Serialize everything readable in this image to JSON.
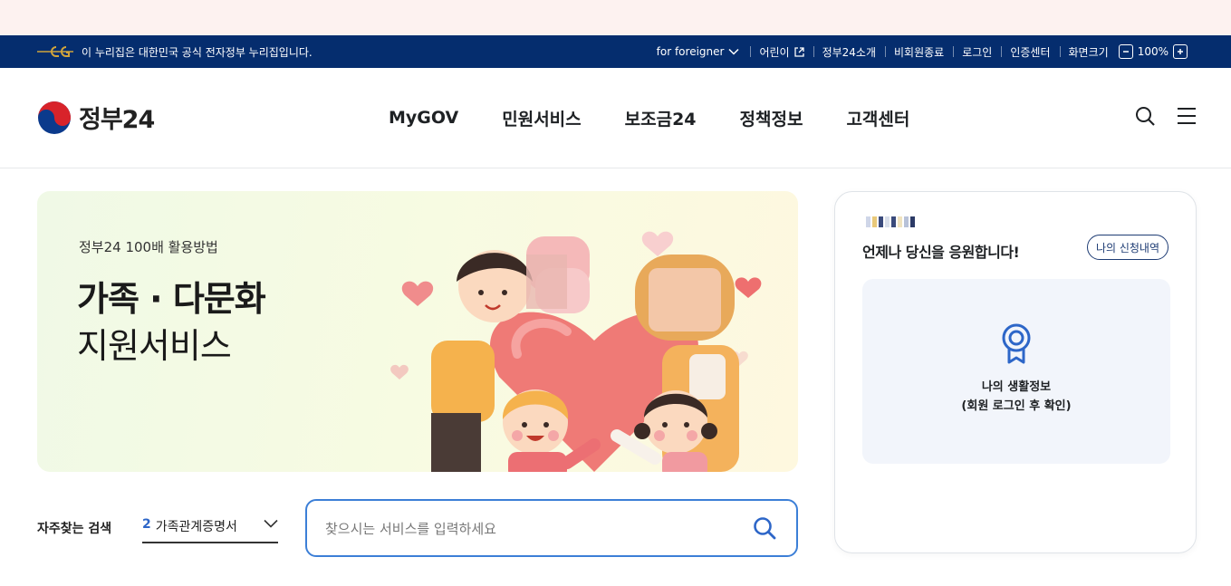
{
  "gov_bar": {
    "notice": "이 누리집은 대한민국 공식 전자정부 누리집입니다.",
    "utils": {
      "foreigner": "for foreigner",
      "kids": "어린이",
      "about": "정부24소개",
      "nonmember_end": "비회원종료",
      "login": "로그인",
      "cert_center": "인증센터",
      "zoom_label": "화면크기",
      "zoom_value": "100%"
    },
    "colors": {
      "background": "#052d6e",
      "emblem": "#d2a53c"
    }
  },
  "header": {
    "logo_text": "정부24",
    "nav": [
      "MyGOV",
      "민원서비스",
      "보조금24",
      "정책정보",
      "고객센터"
    ],
    "icons": [
      "search-icon",
      "menu-icon"
    ]
  },
  "hero": {
    "subtitle": "정부24 100배 활용방법",
    "title_bold": "가족 · 다문화",
    "title_light": "지원서비스"
  },
  "search": {
    "freq_label": "자주찾는 검색",
    "freq_rank": "2",
    "freq_item": "가족관계증명서",
    "placeholder": "찾으시는 서비스를 입력하세요",
    "accent_color": "#3c7fd7"
  },
  "side_card": {
    "greeting": "언제나 당신을 응원합니다!",
    "my_apply_button": "나의 신청내역",
    "life_info_title": "나의 생활정보",
    "life_info_note": "(회원 로그인 후 확인)"
  }
}
